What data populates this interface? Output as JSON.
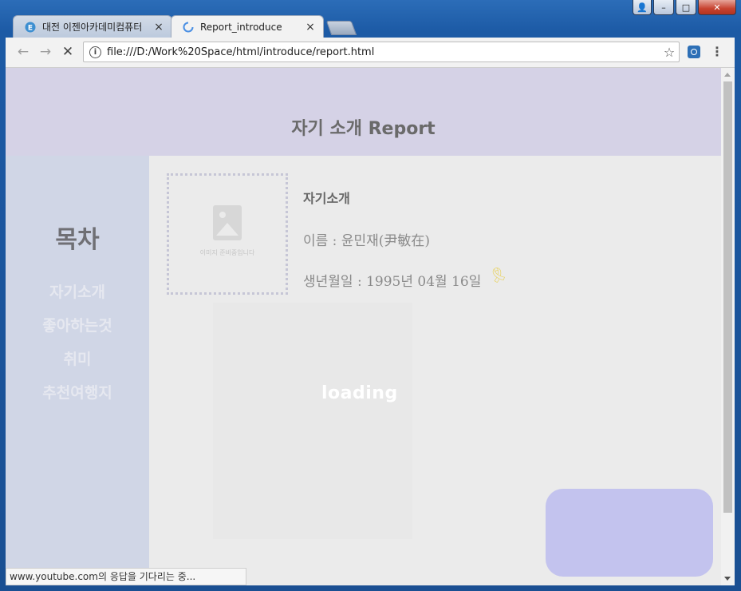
{
  "window": {
    "controls": {
      "user": "👤",
      "minimize": "–",
      "maximize": "□",
      "close": "✕"
    }
  },
  "tabs": [
    {
      "title": "대전 이젠아카데미컴퓨터",
      "icon": "e-site-icon",
      "close": "×",
      "active": false
    },
    {
      "title": "Report_introduce",
      "icon": "loading-spinner-icon",
      "close": "×",
      "active": true
    }
  ],
  "toolbar": {
    "back": "←",
    "forward": "→",
    "stop": "✕",
    "url": "file:///D:/Work%20Space/html/introduce/report.html",
    "info_icon": "i",
    "star": "☆",
    "menu": "⋮"
  },
  "page": {
    "header_title": "자기 소개 Report",
    "sidebar": {
      "title": "목차",
      "items": [
        "자기소개",
        "좋아하는것",
        "취미",
        "추천여행지"
      ]
    },
    "profile": {
      "photo_caption": "이미지 준비중입니다",
      "heading": "자기소개",
      "name_line": "이름 : 윤민재(尹敏在)",
      "birth_line": "생년월일 : 1995년 04월 16일",
      "ribbon": "🎗"
    },
    "loading_text": "loading"
  },
  "status_bar": "www.youtube.com의 응답을 기다리는 중...",
  "colors": {
    "header_bg": "#d5d2e6",
    "sidebar_bg": "#d0d6e6",
    "content_bg": "#ebebeb",
    "floating_box": "#c3c3ee"
  }
}
